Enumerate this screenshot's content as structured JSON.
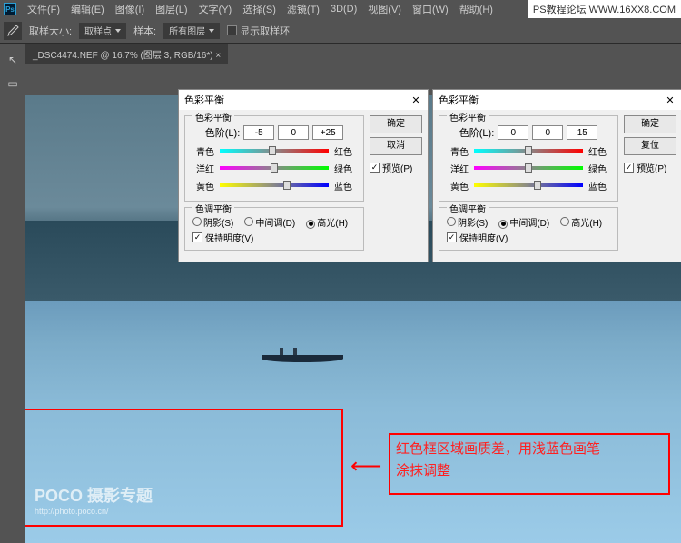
{
  "top_right_text": "PS教程论坛 WWW.16XX8.COM",
  "menu": {
    "file": "文件(F)",
    "edit": "编辑(E)",
    "image": "图像(I)",
    "layer": "图层(L)",
    "type": "文字(Y)",
    "select": "选择(S)",
    "filter": "滤镜(T)",
    "three_d": "3D(D)",
    "view": "视图(V)",
    "window": "窗口(W)",
    "help": "帮助(H)"
  },
  "toolbar": {
    "sample_size_label": "取样大小:",
    "sample_size_value": "取样点",
    "sample_label": "样本:",
    "sample_value": "所有图层",
    "show_ring": "显示取样环"
  },
  "doc_tab": "_DSC4474.NEF @ 16.7% (图层 3, RGB/16*) ×",
  "dialog": {
    "title": "色彩平衡",
    "section_balance": "色彩平衡",
    "level_label": "色阶(L):",
    "cyan": "青色",
    "red": "红色",
    "magenta": "洋红",
    "green": "绿色",
    "yellow": "黄色",
    "blue": "蓝色",
    "section_tone": "色调平衡",
    "shadows": "阴影(S)",
    "midtones": "中间调(D)",
    "highlights": "高光(H)",
    "preserve_lum": "保持明度(V)",
    "ok": "确定",
    "cancel": "取消",
    "reset": "复位",
    "preview": "预览(P)"
  },
  "dialog1_values": {
    "v1": "-5",
    "v2": "0",
    "v3": "+25",
    "tone": "highlights"
  },
  "dialog2_values": {
    "v1": "0",
    "v2": "0",
    "v3": "15",
    "tone": "midtones"
  },
  "annotation": {
    "line1": "红色框区域画质差，用浅蓝色画笔",
    "line2": "涂抹调整"
  },
  "watermark": {
    "brand": "POCO 摄影专题",
    "url": "http://photo.poco.cn/"
  }
}
